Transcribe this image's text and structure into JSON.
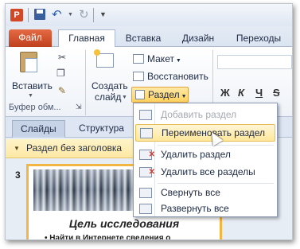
{
  "qat": {
    "logo": "P"
  },
  "ribbon_tabs": [
    "Файл",
    "Главная",
    "Вставка",
    "Дизайн",
    "Переходы"
  ],
  "clipboard": {
    "paste_label": "Вставить",
    "caption": "Буфер обм..."
  },
  "slides_group": {
    "new_slide_line1": "Создать",
    "new_slide_line2": "слайд",
    "layout": "Макет",
    "reset": "Восстановить",
    "section": "Раздел"
  },
  "format": {
    "bold": "Ж",
    "italic": "К",
    "underline": "Ч",
    "strike": "S"
  },
  "pane_tabs": [
    "Слайды",
    "Структура"
  ],
  "section_header": "Раздел без заголовка",
  "slide": {
    "number": "3",
    "title": "Цель исследования",
    "bullet": "• Найти  в Интернете сведения о"
  },
  "section_menu": {
    "items": [
      {
        "label": "Добавить раздел",
        "state": "disabled",
        "icon": "add-section-icon"
      },
      {
        "label": "Переименовать раздел",
        "state": "hover",
        "icon": "rename-section-icon"
      },
      {
        "label": "Удалить раздел",
        "state": "normal",
        "icon": "delete-section-icon"
      },
      {
        "label": "Удалить все разделы",
        "state": "normal",
        "icon": "delete-all-sections-icon"
      },
      {
        "label": "Свернуть все",
        "state": "normal",
        "icon": "collapse-all-icon"
      },
      {
        "label": "Развернуть все",
        "state": "normal",
        "icon": "expand-all-icon"
      }
    ]
  },
  "colors": {
    "file_tab": "#d24726",
    "section_highlight": "#ffd25e",
    "menu_hover": "#ffe79a"
  }
}
